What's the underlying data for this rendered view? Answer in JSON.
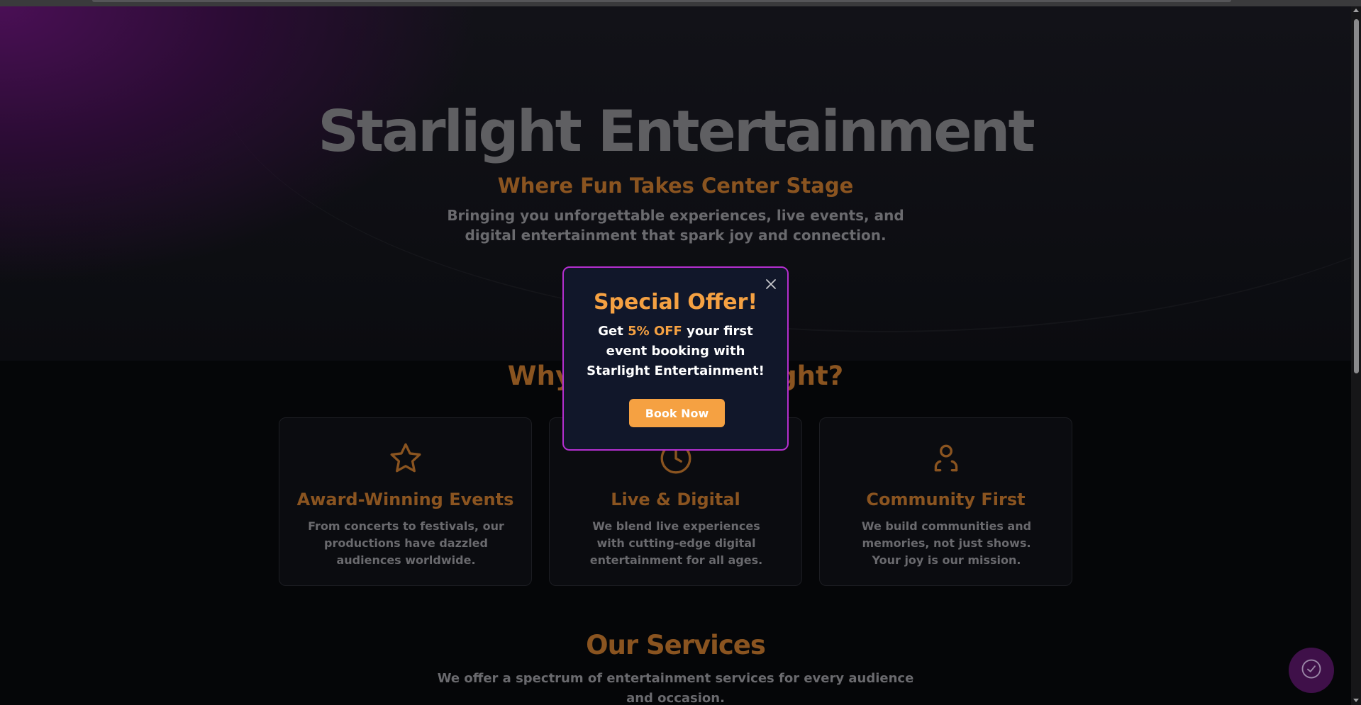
{
  "hero": {
    "title": "Starlight Entertainment",
    "tagline": "Where Fun Takes Center Stage",
    "description": "Bringing you unforgettable experiences, live events, and digital entertainment that spark joy and connection."
  },
  "why_section": {
    "title": "Why Choose Starlight?"
  },
  "features": [
    {
      "icon": "star-icon",
      "title": "Award-Winning Events",
      "description": "From concerts to festivals, our productions have dazzled audiences worldwide."
    },
    {
      "icon": "clock-icon",
      "title": "Live & Digital",
      "description": "We blend live experiences with cutting-edge digital entertainment for all ages."
    },
    {
      "icon": "user-icon",
      "title": "Community First",
      "description": "We build communities and memories, not just shows. Your joy is our mission."
    }
  ],
  "services": {
    "title": "Our Services",
    "description": "We offer a spectrum of entertainment services for every audience and occasion."
  },
  "modal": {
    "title": "Special Offer!",
    "text_before": "Get ",
    "highlight": "5% OFF",
    "text_after": " your first event booking with Starlight Entertainment!",
    "button_label": "Book Now",
    "close_icon": "close-icon"
  },
  "floating_button": {
    "icon": "check-circle-icon"
  },
  "colors": {
    "accent_orange": "#f5a142",
    "modal_border": "#b42fcf",
    "modal_bg": "#11172a",
    "fab_bg": "#3f1049"
  }
}
